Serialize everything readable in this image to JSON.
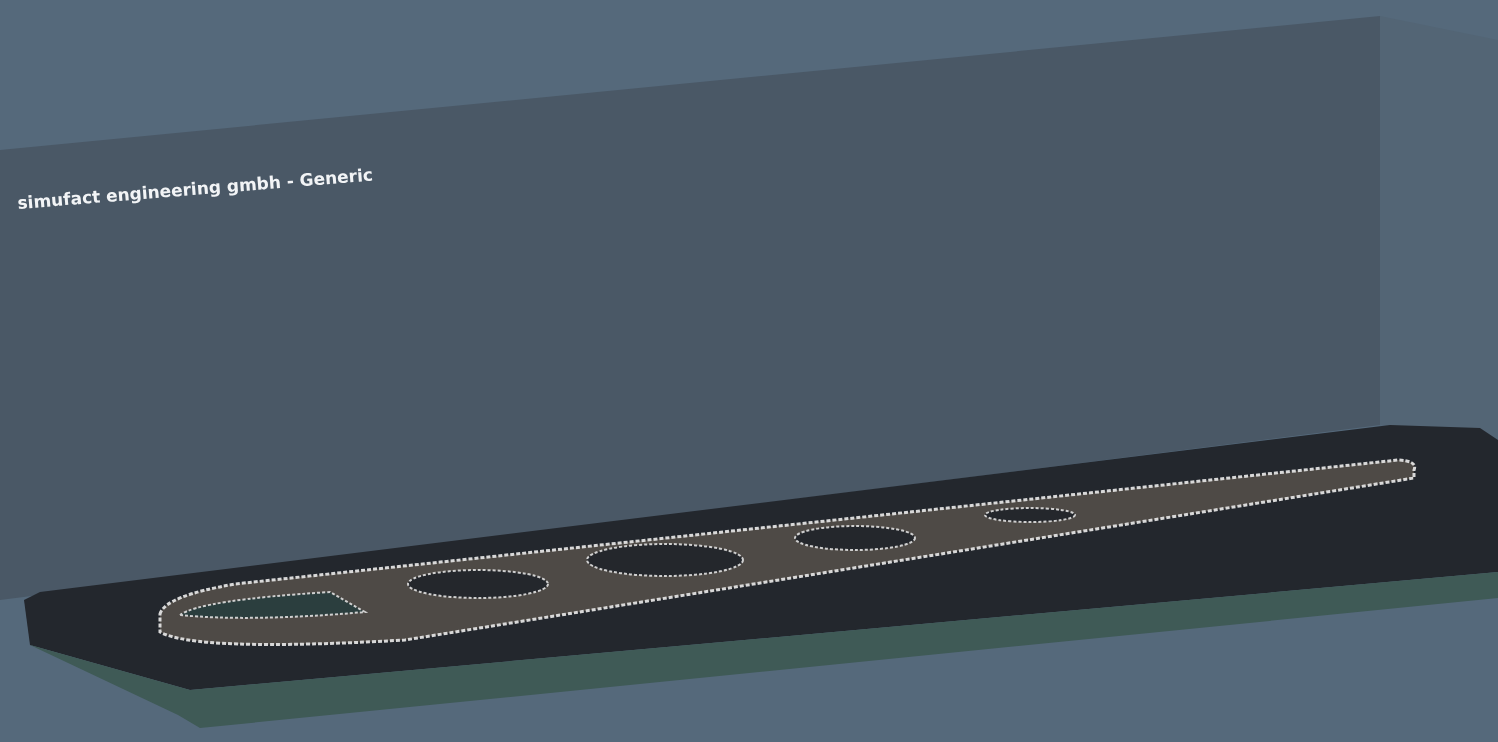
{
  "viewport": {
    "label": "simufact engineering gmbh - Generic"
  }
}
